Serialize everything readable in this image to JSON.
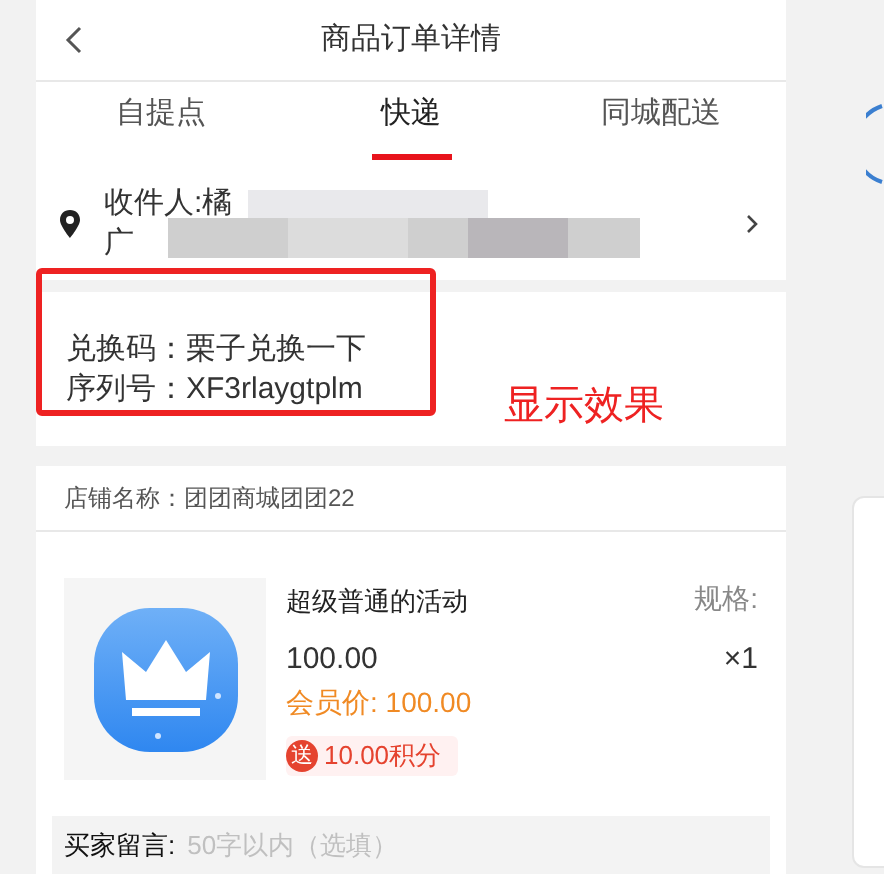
{
  "header": {
    "title": "商品订单详情"
  },
  "tabs": [
    {
      "label": "自提点",
      "selected": false
    },
    {
      "label": "快递",
      "selected": true
    },
    {
      "label": "同城配送",
      "selected": false
    }
  ],
  "address": {
    "recipient": "收件人:橘",
    "address": "广"
  },
  "redeem": {
    "lines": [
      "兑换码：栗子兑换一下",
      "序列号：XF3rlaygtplm"
    ],
    "annotation": "显示效果"
  },
  "store": {
    "name": "店铺名称：团团商城团团22"
  },
  "product": {
    "name": "超级普通的活动",
    "price": "100.00",
    "member_price": "会员价: 100.00",
    "gift_badge": "送",
    "points": "10.00积分",
    "spec_label": "规格:",
    "quantity": "×1"
  },
  "message": {
    "label": "买家留言:",
    "placeholder": "50字以内（选填）"
  }
}
